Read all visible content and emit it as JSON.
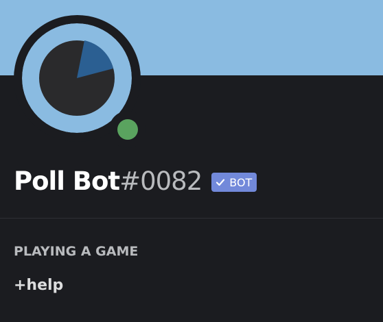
{
  "colors": {
    "banner": "#8abbe1",
    "background": "#1b1c20",
    "avatar_ring": "#8abbe1",
    "avatar_pie_dark": "#2a2a2c",
    "avatar_pie_slice": "#2b5f92",
    "status_online": "#5aa35f",
    "bot_tag": "#7289da"
  },
  "profile": {
    "username": "Poll Bot",
    "discriminator": "#0082",
    "bot_tag_label": "BOT",
    "status": "online",
    "avatar_icon": "pie-chart-icon"
  },
  "activity_section": {
    "title": "PLAYING A GAME",
    "game": "+help"
  }
}
